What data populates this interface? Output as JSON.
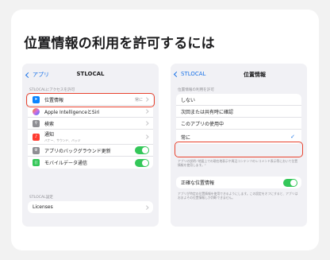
{
  "headline": "位置情報の利用を許可するには",
  "left_screen": {
    "back_label": "アプリ",
    "title": "STLOCAL",
    "section_header": "STLOCALにアクセスを許可",
    "rows": [
      {
        "label": "位置情報",
        "value": "常に",
        "icon": "location-arrow-icon",
        "color": "#0a84ff"
      },
      {
        "label": "Apple IntelligenceとSiri",
        "icon": "siri-icon",
        "color": "#d36be0"
      },
      {
        "label": "検索",
        "icon": "search-icon",
        "color": "#8e8e93"
      },
      {
        "label": "通知",
        "sub": "バナー、サウンド、バッジ",
        "icon": "bell-icon",
        "color": "#ff3b30"
      },
      {
        "label": "アプリのバックグラウンド更新",
        "icon": "gear-icon",
        "color": "#8e8e93"
      },
      {
        "label": "モバイルデータ通信",
        "icon": "antenna-icon",
        "color": "#34c759"
      }
    ],
    "settings_header": "STLOCAL設定",
    "licenses_label": "Licenses"
  },
  "right_screen": {
    "back_label": "STLOCAL",
    "title": "位置情報",
    "section_header": "位置情報の利用を許可",
    "options": [
      "しない",
      "次回または共有時に確認",
      "このアプリの使用中",
      "常に"
    ],
    "selected": "常に",
    "option_note": "アプリの説明:\"地図上での現在地表示や周辺コンテンツのレコメンド表示等において位置情報を使用します。\"",
    "precise_label": "正確な位置情報",
    "precise_note": "アプリが特定の位置情報を使用できるようにします。この設定をオフにすると、アプリはおおよその位置情報しか判断できません。"
  },
  "colors": {
    "highlight": "#e8432f",
    "accent": "#1a73e8",
    "toggle_on": "#34c759"
  }
}
